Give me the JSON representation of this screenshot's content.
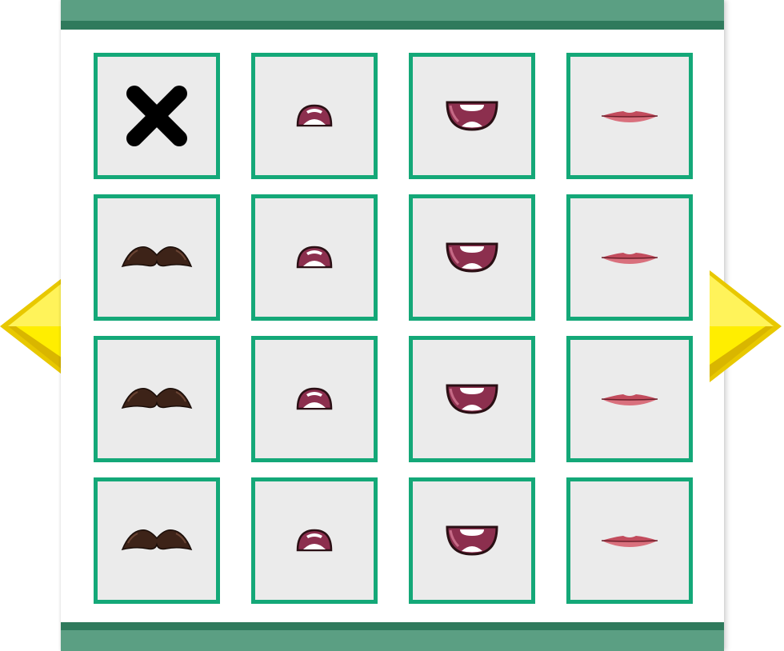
{
  "screen": "mouth-picker",
  "colors": {
    "frame_green": "#14a878",
    "bar_light": "#5b9f83",
    "bar_dark": "#2f7a5c",
    "cell_bg": "#ebebeb",
    "arrow_yellow": "#ffee00"
  },
  "navigation": {
    "prev": "yellow-left-arrow",
    "next": "yellow-right-arrow"
  },
  "grid": {
    "rows": 4,
    "columns": 4,
    "items": [
      [
        "none-x-icon",
        "small-open-mouth-icon",
        "wide-smile-mouth-icon",
        "lips-icon"
      ],
      [
        "mustache-icon",
        "small-open-mouth-icon",
        "wide-smile-mouth-icon",
        "lips-icon"
      ],
      [
        "mustache-icon",
        "small-open-mouth-icon",
        "wide-smile-mouth-icon",
        "lips-icon"
      ],
      [
        "mustache-icon",
        "small-open-mouth-icon",
        "wide-smile-mouth-icon",
        "lips-icon"
      ]
    ]
  }
}
